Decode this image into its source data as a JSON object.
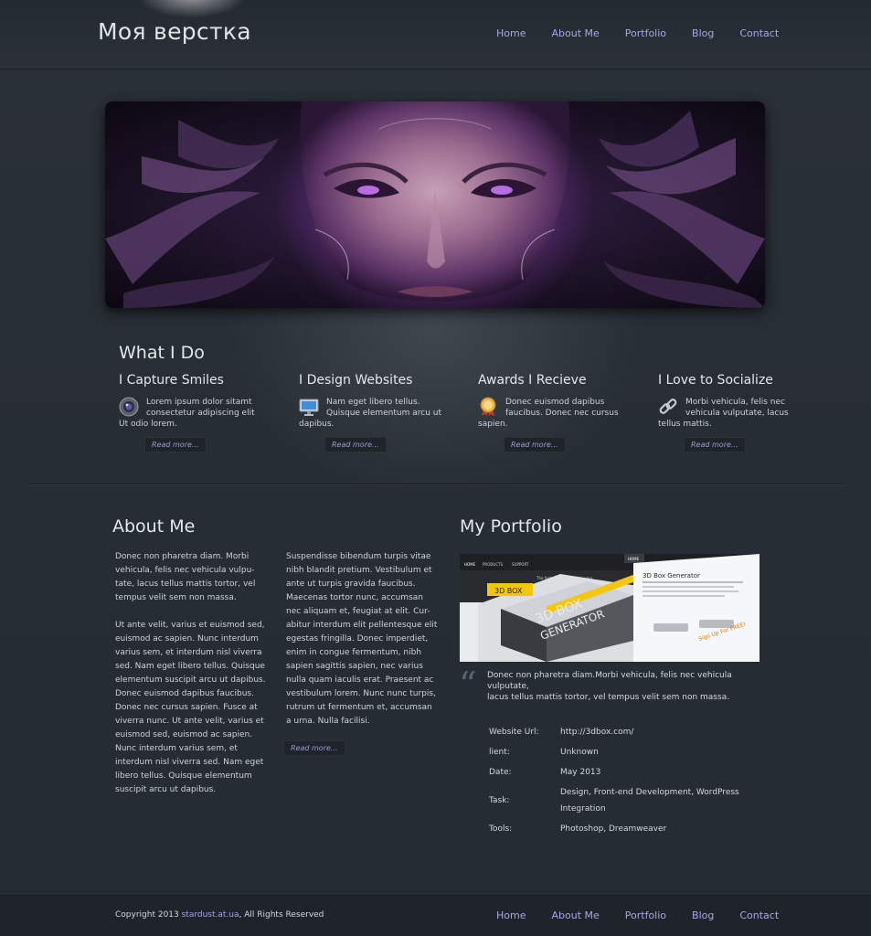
{
  "header": {
    "logo": "Моя верстка"
  },
  "nav": [
    {
      "label": "Home"
    },
    {
      "label": "About Me"
    },
    {
      "label": "Portfolio"
    },
    {
      "label": "Blog"
    },
    {
      "label": "Contact"
    }
  ],
  "what_i_do": {
    "title": "What I Do",
    "features": [
      {
        "title": "I Capture Smiles",
        "icon": "camera-lens-icon",
        "text": "Lorem ipsum dolor sitamt consectetur adipiscing elit Ut odio lorem.",
        "readmore": "Read more..."
      },
      {
        "title": "I Design Websites",
        "icon": "monitor-icon",
        "text": "Nam eget libero tellus. Quisque elementum arcu ut dapibus.",
        "readmore": "Read more..."
      },
      {
        "title": "Awards I Recieve",
        "icon": "award-medal-icon",
        "text": "Donec euismod dapibus faucibus. Donec nec cursus sapien.",
        "readmore": "Read more..."
      },
      {
        "title": "I Love to Socialize",
        "icon": "chain-link-icon",
        "text": "Morbi vehicula, felis nec vehicula vulputate, lacus tellus mattis.",
        "readmore": "Read more..."
      }
    ]
  },
  "about": {
    "title": "About Me",
    "col1": "Donec non pharetra diam. Morbi\nvehicula, felis nec vehicula vulpu-\ntate, lacus tellus mattis tortor, vel\ntempus velit sem non massa.\n\nUt ante velit, varius et euismod sed,\neuismod ac sapien. Nunc interdum\nvarius sem, et interdum nisl viverra\nsed. Nam eget libero tellus. Quisque\nelementum suscipit arcu ut dapibus.\nDonec euismod dapibus faucibus.\nDonec nec cursus sapien. Fusce at\nviverra nunc. Ut ante velit, varius et\neuismod sed, euismod ac sapien.\nNunc interdum varius sem, et\ninterdum nisl viverra sed. Nam eget\nlibero tellus. Quisque elementum\nsuscipit arcu ut dapibus.",
    "col2": "Suspendisse bibendum turpis vitae\nnibh blandit pretium. Vestibulum et\nante ut turpis gravida faucibus.\nMaecenas tortor nunc, accumsan\nnec aliquam et, feugiat at elit. Cur-\nabitur interdum elit pellentesque elit\negestas fringilla. Donec imperdiet,\nenim in congue fermentum, nibh\nsapien sagittis sapien, nec varius\nnulla quam iaculis erat. Praesent ac\nvestibulum lorem. Nunc nunc turpis,\nrutrum ut fermentum et, accumsan\na urna. Nulla facilisi.",
    "readmore": "Read more..."
  },
  "portfolio": {
    "title": "My Portfolio",
    "image": {
      "nav_items": [
        "HOME",
        "PRODUCTS",
        "SUPPORT"
      ],
      "top_tab": "HOME",
      "logo": "3D BOX",
      "tagline": "The fastest way to create your",
      "box_label_1": "3D BOX",
      "box_label_2": "GENERATOR",
      "right_title": "3D Box Generator",
      "cta": "Sign Up For FREE!"
    },
    "quote_mark": "“",
    "quote": "Donec non pharetra diam.Morbi vehicula, felis nec vehicula vulputate,\nlacus tellus mattis tortor, vel tempus velit sem non massa.",
    "details": [
      {
        "label": "Website Url:",
        "value": "http://3dbox.com/"
      },
      {
        "label": "lient:",
        "value": "Unknown"
      },
      {
        "label": "Date:",
        "value": "May 2013"
      },
      {
        "label": "Task:",
        "value": "Design, Front-end Development, WordPress Integration"
      },
      {
        "label": "Tools:",
        "value": "Photoshop, Dreamweaver"
      }
    ]
  },
  "footer": {
    "copyright_prefix": "Copyright 2013 ",
    "copyright_link": "stardust.at.ua",
    "copyright_suffix": ", All Rights Reserved"
  },
  "colors": {
    "accent": "#a6a6e8",
    "background": "#252b33",
    "footer": "#1f242a"
  }
}
